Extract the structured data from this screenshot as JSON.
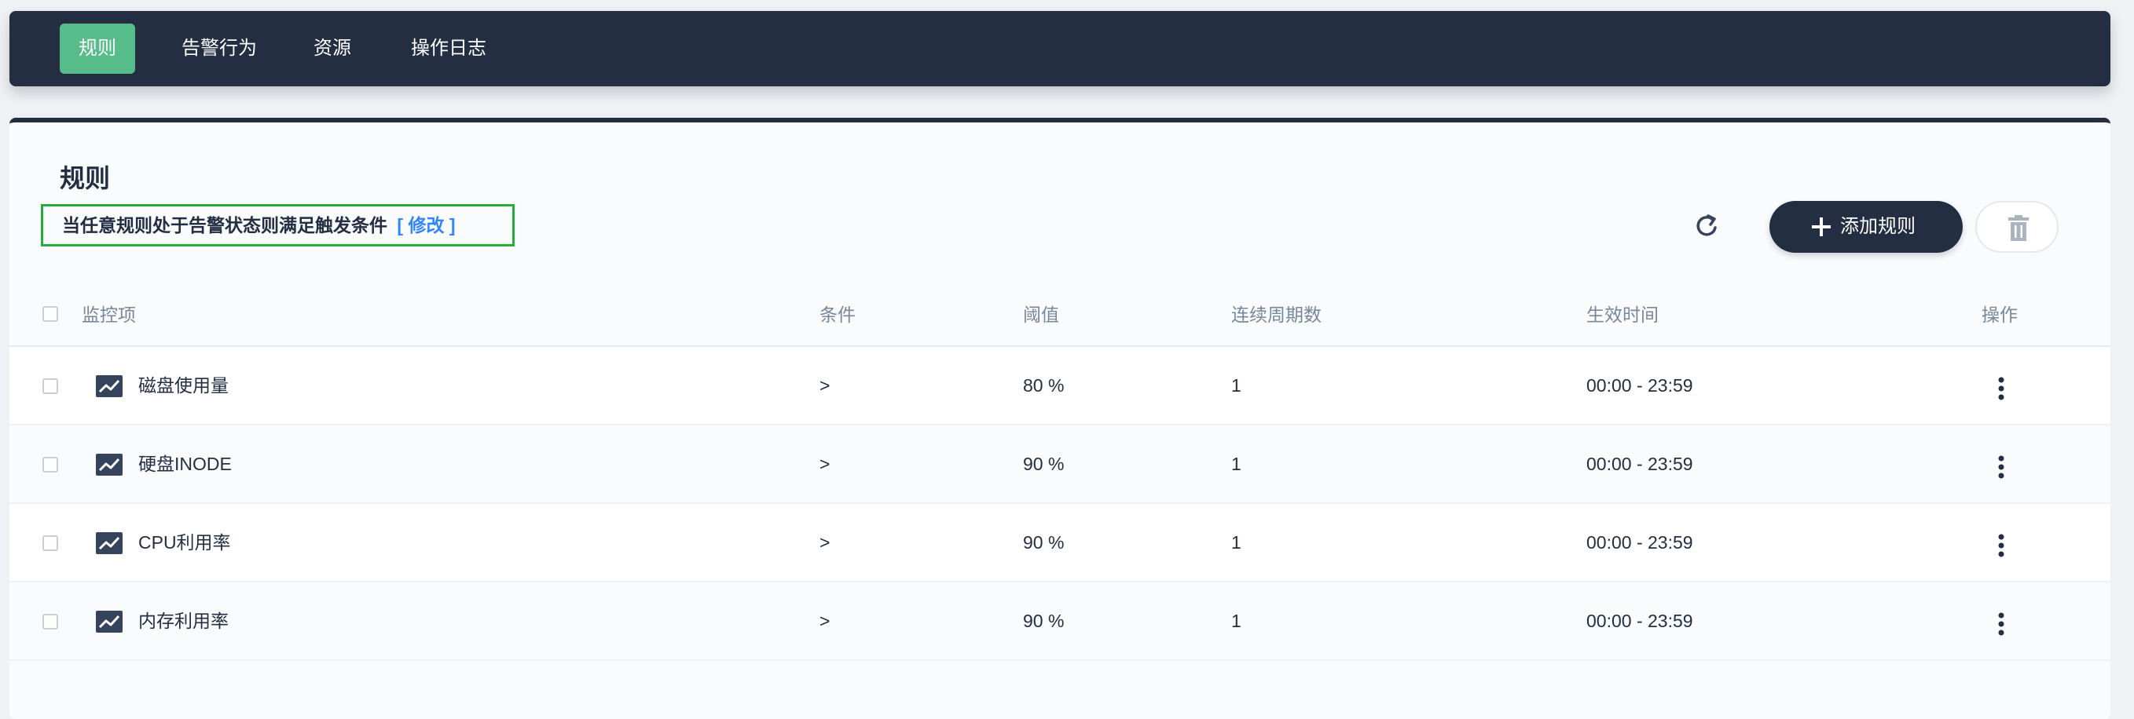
{
  "nav": {
    "tabs": [
      {
        "label": "规则",
        "active": true
      },
      {
        "label": "告警行为",
        "active": false
      },
      {
        "label": "资源",
        "active": false
      },
      {
        "label": "操作日志",
        "active": false
      }
    ]
  },
  "panel": {
    "title": "规则",
    "trigger_text": "当任意规则处于告警状态则满足触发条件",
    "trigger_edit": "[ 修改 ]",
    "add_label": "添加规则"
  },
  "table": {
    "headers": {
      "name": "监控项",
      "condition": "条件",
      "threshold": "阈值",
      "cycles": "连续周期数",
      "time": "生效时间",
      "actions": "操作"
    },
    "rows": [
      {
        "name": "磁盘使用量",
        "condition": ">",
        "threshold": "80 %",
        "cycles": "1",
        "time": "00:00 - 23:59"
      },
      {
        "name": "硬盘INODE",
        "condition": ">",
        "threshold": "90 %",
        "cycles": "1",
        "time": "00:00 - 23:59"
      },
      {
        "name": "CPU利用率",
        "condition": ">",
        "threshold": "90 %",
        "cycles": "1",
        "time": "00:00 - 23:59"
      },
      {
        "name": "内存利用率",
        "condition": ">",
        "threshold": "90 %",
        "cycles": "1",
        "time": "00:00 - 23:59"
      }
    ]
  },
  "colors": {
    "nav_bg": "#242e42",
    "active_tab": "#55bc8a",
    "trigger_border": "#24ad3b",
    "link": "#3385ff"
  },
  "icons": [
    "refresh-icon",
    "plus-icon",
    "trash-icon",
    "line-chart-icon",
    "more-vertical-icon"
  ]
}
